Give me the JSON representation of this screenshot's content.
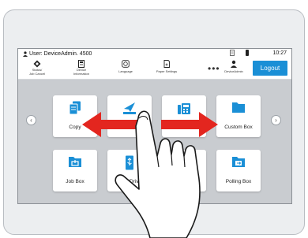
{
  "status_bar": {
    "user_text": "User: DeviceAdmin. 4500",
    "time": "10:27"
  },
  "toolbar": {
    "status_job_cancel": {
      "line1": "Status/",
      "line2": "Job Cancel"
    },
    "device_information": {
      "line1": "Device",
      "line2": "Information"
    },
    "language": "Language",
    "paper_settings": "Paper Settings",
    "more": "•••",
    "user": "DeviceAdmin",
    "logout": "Logout"
  },
  "home": {
    "tiles": [
      {
        "label": "Copy"
      },
      {
        "label": "Send"
      },
      {
        "label": "Fax"
      },
      {
        "label": "Custom Box"
      },
      {
        "label": "Job Box"
      },
      {
        "label": "USB Drive"
      },
      {
        "label": ""
      },
      {
        "label": "Polling Box"
      }
    ],
    "prev": "‹",
    "next": "›"
  },
  "colors": {
    "accent": "#1a8fd6",
    "arrow": "#e3261f",
    "background": "#c9ccd0"
  },
  "icons": [
    "user-icon",
    "status-icon",
    "device-info-icon",
    "language-icon",
    "paper-settings-icon",
    "user-avatar-icon",
    "copy-icon",
    "send-icon",
    "fax-icon",
    "folder-icon",
    "job-box-icon",
    "usb-icon",
    "polling-box-icon",
    "hand-icon"
  ]
}
